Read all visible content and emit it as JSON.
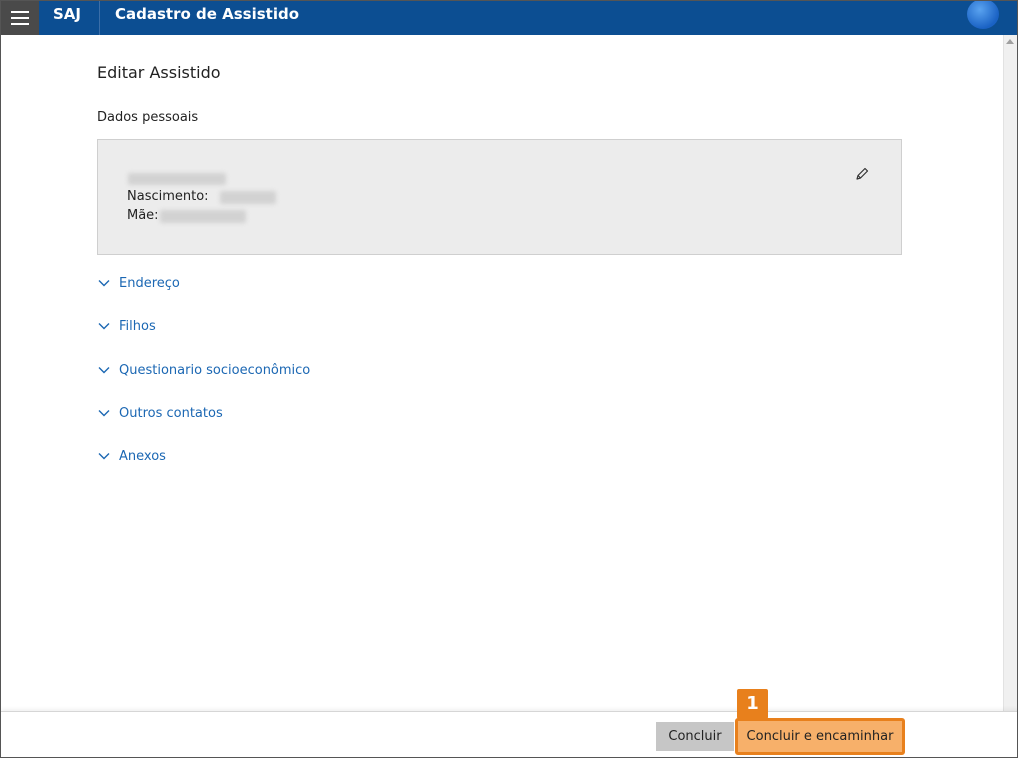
{
  "header": {
    "brand": "SAJ",
    "title": "Cadastro de Assistido"
  },
  "page": {
    "title": "Editar Assistido",
    "section_title": "Dados pessoais"
  },
  "personal_card": {
    "birth_label": "Nascimento:",
    "mother_label": "Mãe:"
  },
  "accordion": [
    {
      "label": "Endereço"
    },
    {
      "label": "Filhos"
    },
    {
      "label": "Questionario socioeconômico"
    },
    {
      "label": "Outros contatos"
    },
    {
      "label": "Anexos"
    }
  ],
  "footer": {
    "concluir_label": "Concluir",
    "encaminhar_label": "Concluir e encaminhar",
    "callout_number": "1"
  },
  "icons": {
    "menu": "hamburger-icon",
    "avatar": "user-avatar",
    "edit": "pencil-icon",
    "expand": "chevron-down-icon"
  },
  "colors": {
    "header_bg": "#0c4e92",
    "link": "#1b67b3",
    "highlight": "#e8801c",
    "highlight_fill": "#f7b06a"
  }
}
